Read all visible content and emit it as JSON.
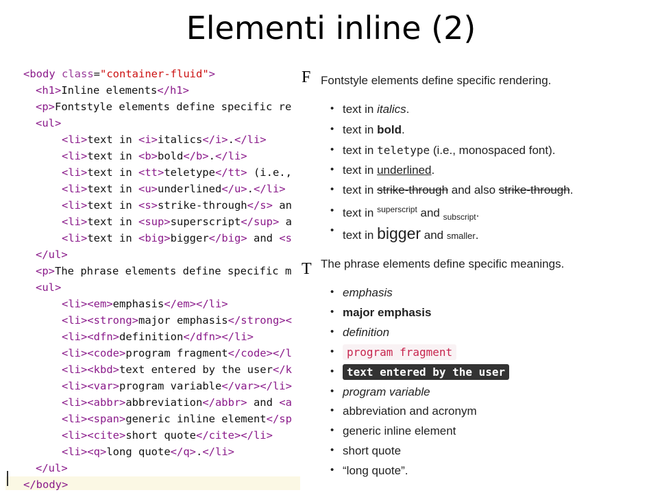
{
  "slide": {
    "title": "Elementi inline (2)"
  },
  "code": {
    "l1": [
      "<body",
      " class",
      "=",
      "\"container-fluid\"",
      ">"
    ],
    "l2": [
      "<h1>",
      "Inline elements",
      "</h1>"
    ],
    "l3": [
      "<p>",
      "Fontstyle elements define specific re"
    ],
    "l4": [
      "<ul>"
    ],
    "l5": [
      "<li>",
      "text in ",
      "<i>",
      "italics",
      "</i>",
      ".",
      "</li>"
    ],
    "l6": [
      "<li>",
      "text in ",
      "<b>",
      "bold",
      "</b>",
      ".",
      "</li>"
    ],
    "l7": [
      "<li>",
      "text in ",
      "<tt>",
      "teletype",
      "</tt>",
      " (i.e.,"
    ],
    "l8": [
      "<li>",
      "text in ",
      "<u>",
      "underlined",
      "</u>",
      ".",
      "</li>"
    ],
    "l9": [
      "<li>",
      "text in ",
      "<s>",
      "strike-through",
      "</s>",
      " an"
    ],
    "l10": [
      "<li>",
      "text in ",
      "<sup>",
      "superscript",
      "</sup>",
      " a"
    ],
    "l11": [
      "<li>",
      "text in ",
      "<big>",
      "bigger",
      "</big>",
      " and ",
      "<s"
    ],
    "l12": [
      "</ul>"
    ],
    "l13": [
      "<p>",
      "The phrase elements define specific m"
    ],
    "l14": [
      "<ul>"
    ],
    "l15": [
      "<li>",
      "<em>",
      "emphasis",
      "</em>",
      "</li>"
    ],
    "l16": [
      "<li>",
      "<strong>",
      "major emphasis",
      "</strong><"
    ],
    "l17": [
      "<li>",
      "<dfn>",
      "definition",
      "</dfn>",
      "</li>"
    ],
    "l18": [
      "<li>",
      "<code>",
      "program fragment",
      "</code></l"
    ],
    "l19": [
      "<li>",
      "<kbd>",
      "text entered by the user",
      "</k"
    ],
    "l20": [
      "<li>",
      "<var>",
      "program variable",
      "</var>",
      "</li>"
    ],
    "l21": [
      "<li>",
      "<abbr>",
      "abbreviation",
      "</abbr>",
      " and ",
      "<a"
    ],
    "l22": [
      "<li>",
      "<span>",
      "generic inline element",
      "</sp"
    ],
    "l23": [
      "<li>",
      "<cite>",
      "short quote",
      "</cite>",
      "</li>"
    ],
    "l24": [
      "<li>",
      "<q>",
      "long quote",
      "</q>",
      ".",
      "</li>"
    ],
    "l25": [
      "</ul>"
    ],
    "l26": [
      "</body>"
    ]
  },
  "render": {
    "p1_drop": "F",
    "p1_text": "Fontstyle elements define specific rendering.",
    "i1": [
      "text in ",
      "italics",
      "."
    ],
    "i2": [
      "text in ",
      "bold",
      "."
    ],
    "i3": [
      "text in ",
      "teletype",
      " (i.e., monospaced font)."
    ],
    "i4": [
      "text in ",
      "underlined",
      "."
    ],
    "i5": [
      "text in ",
      "strike-through",
      " and also ",
      "strike-through",
      "."
    ],
    "i6": [
      "text in ",
      "superscript",
      " and ",
      "subscript",
      "."
    ],
    "i7": [
      "text in ",
      "bigger",
      " and ",
      "smaller",
      "."
    ],
    "p2_drop": "T",
    "p2_text": "The phrase elements define specific meanings.",
    "j1": "emphasis",
    "j2": "major emphasis",
    "j3": "definition",
    "j4": "program fragment",
    "j5": "text entered by the user",
    "j6": "program variable",
    "j7": "abbreviation and acronym",
    "j8": "generic inline element",
    "j9": "short quote",
    "j10": [
      "“",
      "long quote",
      "”."
    ]
  }
}
